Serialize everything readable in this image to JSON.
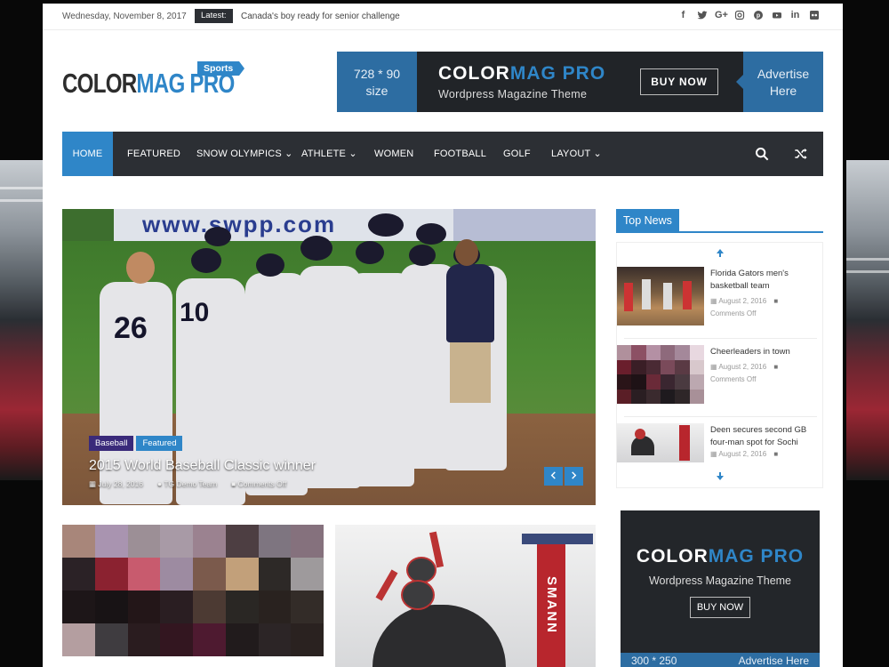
{
  "topbar": {
    "date": "Wednesday, November 8, 2017",
    "latest_label": "Latest:",
    "latest_headline": "Canada's boy ready for senior challenge",
    "social_icons": [
      "facebook-icon",
      "twitter-icon",
      "google-plus-icon",
      "instagram-icon",
      "pinterest-icon",
      "youtube-icon",
      "linkedin-icon",
      "flickr-icon"
    ]
  },
  "header": {
    "logo_part1": "COLOR",
    "logo_part2": "MAG PRO",
    "logo_tag": "Sports",
    "banner": {
      "left_line1": "728 * 90",
      "left_line2": "size",
      "logo_part1": "COLOR",
      "logo_part2": "MAG PRO",
      "subtitle": "Wordpress Magazine Theme",
      "button": "BUY NOW",
      "right_line1": "Advertise",
      "right_line2": "Here"
    }
  },
  "nav": {
    "items": [
      {
        "label": "HOME",
        "active": true
      },
      {
        "label": "FEATURED"
      },
      {
        "label": "SNOW OLYMPICS ⌄"
      },
      {
        "label": "ATHLETE ⌄"
      },
      {
        "label": "WOMEN"
      },
      {
        "label": "FOOTBALL"
      },
      {
        "label": "GOLF"
      },
      {
        "label": "LAYOUT ⌄"
      }
    ],
    "search_icon": "search-icon",
    "random_icon": "shuffle-icon"
  },
  "slider": {
    "banner_text": "www.swpp.com",
    "jersey_1": "26",
    "jersey_2": "10",
    "categories": [
      {
        "label": "Baseball",
        "color": "#3a2a7a"
      },
      {
        "label": "Featured",
        "color": "#2f86c8"
      }
    ],
    "title": "2015 World Baseball Classic winner",
    "meta": {
      "date": "July 28, 2016",
      "author": "TG Demo Team",
      "comments": "Comments Off"
    }
  },
  "sidebar": {
    "widget_title": "Top News",
    "news": [
      {
        "title": "Florida Gators men's basketball team",
        "date": "August 2, 2016",
        "comments": "Comments Off"
      },
      {
        "title": "Cheerleaders in town",
        "date": "August 2, 2016",
        "comments": "Comments Off"
      },
      {
        "title": "Deen secures second GB four-man spot for Sochi",
        "date": "August 2, 2016",
        "comments": ""
      }
    ]
  },
  "bottom": {
    "photo2_sign": "SMANN"
  },
  "ad2": {
    "logo_part1": "COLOR",
    "logo_part2": "MAG PRO",
    "subtitle": "Wordpress Magazine Theme",
    "button": "BUY NOW",
    "foot_left": "300 * 250",
    "foot_right": "Advertise Here"
  },
  "colors": {
    "accent": "#2f86c8",
    "nav_bg": "#2c2f34",
    "ad_blue": "#2d6da2"
  }
}
